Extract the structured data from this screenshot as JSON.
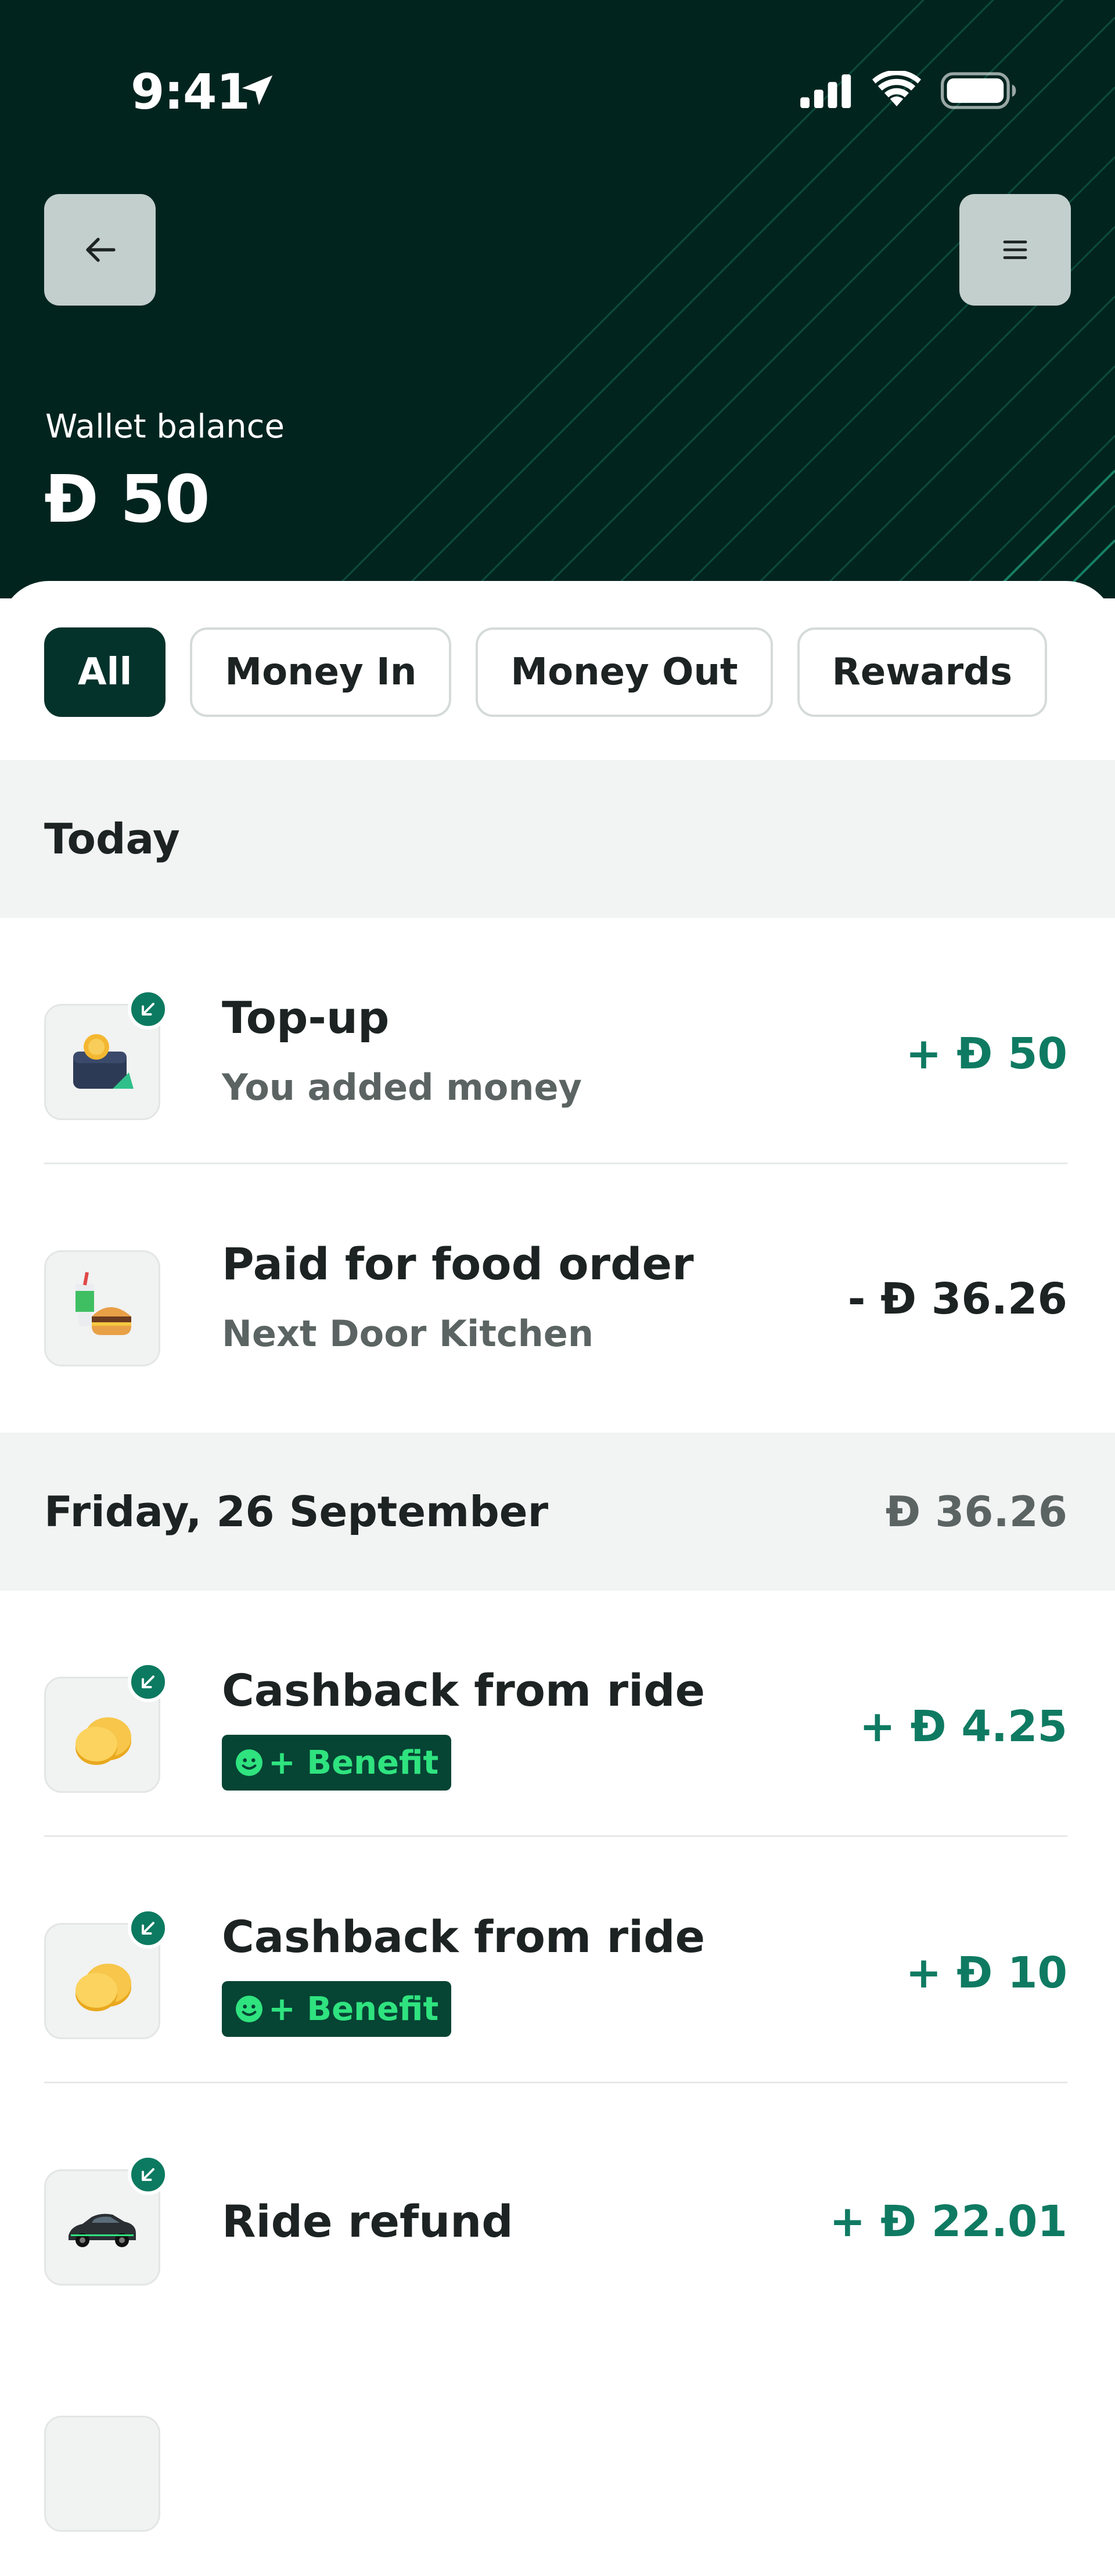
{
  "status_bar": {
    "time": "9:41"
  },
  "header": {
    "back_icon": "arrow-left-icon",
    "menu_icon": "hamburger-menu-icon",
    "balance_label": "Wallet balance",
    "balance_amount": "Đ 50"
  },
  "colors": {
    "header_bg": "#02241f",
    "accent_green": "#0f7a62",
    "benefit_bg": "#064434",
    "benefit_text": "#2fe37f",
    "chip_active_bg": "#04332b"
  },
  "tabs": [
    {
      "label": "All",
      "active": true
    },
    {
      "label": "Money In",
      "active": false
    },
    {
      "label": "Money Out",
      "active": false
    },
    {
      "label": "Rewards",
      "active": false
    }
  ],
  "sections": [
    {
      "title": "Today",
      "total": "",
      "transactions": [
        {
          "title": "Top-up",
          "subtitle": "You added money",
          "amount": "+ Đ 50",
          "direction": "in",
          "icon": "wallet-topup-icon"
        },
        {
          "title": "Paid for food order",
          "subtitle": "Next Door Kitchen",
          "amount": "- Đ 36.26",
          "direction": "out",
          "icon": "burger-drink-icon"
        }
      ]
    },
    {
      "title": "Friday, 26 September",
      "total": "Đ 36.26",
      "transactions": [
        {
          "title": "Cashback from ride",
          "badge": "+ Benefit",
          "amount": "+ Đ 4.25",
          "direction": "in",
          "icon": "coins-icon"
        },
        {
          "title": "Cashback from ride",
          "badge": "+ Benefit",
          "amount": "+ Đ 10",
          "direction": "in",
          "icon": "coins-icon"
        },
        {
          "title": "Ride refund",
          "amount": "+ Đ 22.01",
          "direction": "in",
          "icon": "car-icon"
        }
      ]
    }
  ]
}
